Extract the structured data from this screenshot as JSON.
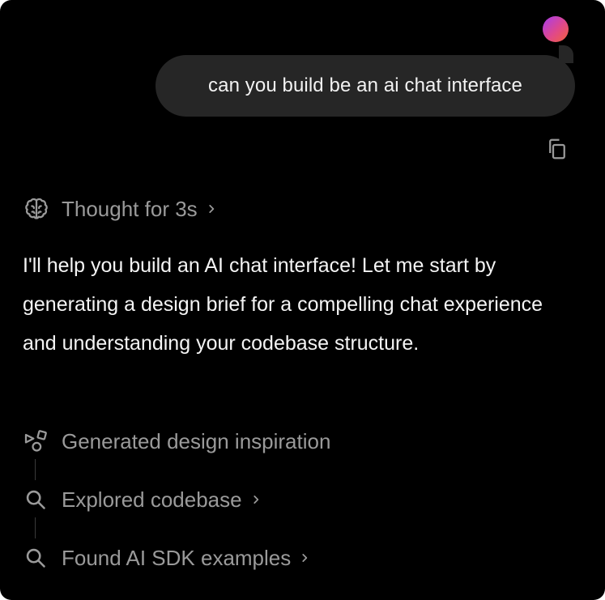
{
  "user_message": {
    "text": "can you build be an ai chat interface"
  },
  "thought": {
    "label": "Thought for 3s",
    "icon": "brain-icon"
  },
  "assistant": {
    "text": "I'll help you build an AI chat interface! Let me start by generating a design brief for a compelling chat experience and understanding your codebase structure."
  },
  "steps": [
    {
      "label": "Generated design inspiration",
      "icon": "shapes-icon"
    },
    {
      "label": "Explored codebase",
      "icon": "search-icon"
    },
    {
      "label": "Found AI SDK examples",
      "icon": "search-icon"
    }
  ],
  "colors": {
    "background": "#000000",
    "bubble": "#262626",
    "muted_text": "#9a9a9a",
    "primary_text": "#f4f4f4"
  }
}
